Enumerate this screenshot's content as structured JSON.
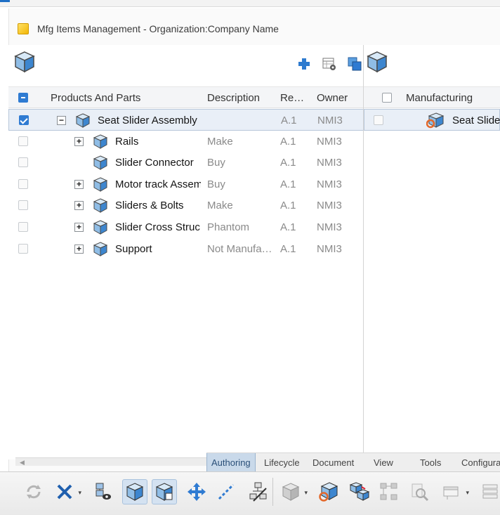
{
  "window": {
    "title": "Mfg Items Management - Organization:Company Name"
  },
  "left_pane": {
    "toolbar": {
      "add_icon": "plus-icon",
      "properties_icon": "table-gear-icon",
      "copy_icon": "copy-icon"
    },
    "columns": [
      "Products And Parts",
      "Description",
      "Re…",
      "Owner"
    ],
    "rows": [
      {
        "name": "Seat Slider Assembly",
        "description": "",
        "revision": "A.1",
        "owner": "NMI3",
        "expander": "−",
        "checked": true,
        "selected": true,
        "level": 0
      },
      {
        "name": "Rails",
        "description": "Make",
        "revision": "A.1",
        "owner": "NMI3",
        "expander": "+",
        "checked": false,
        "level": 1
      },
      {
        "name": "Slider Connector",
        "description": "Buy",
        "revision": "A.1",
        "owner": "NMI3",
        "expander": "",
        "checked": false,
        "level": 1
      },
      {
        "name": "Motor track Assem",
        "description": "Buy",
        "revision": "A.1",
        "owner": "NMI3",
        "expander": "+",
        "checked": false,
        "level": 1
      },
      {
        "name": "Sliders & Bolts",
        "description": "Make",
        "revision": "A.1",
        "owner": "NMI3",
        "expander": "+",
        "checked": false,
        "level": 1
      },
      {
        "name": "Slider Cross Struc",
        "description": "Phantom",
        "revision": "A.1",
        "owner": "NMI3",
        "expander": "+",
        "checked": false,
        "level": 1
      },
      {
        "name": "Support",
        "description": "Not Manufa…",
        "revision": "A.1",
        "owner": "NMI3",
        "expander": "+",
        "checked": false,
        "level": 1
      }
    ]
  },
  "right_pane": {
    "columns": [
      "Manufacturing"
    ],
    "rows": [
      {
        "name": "Seat Slider"
      }
    ]
  },
  "tabs": [
    "Authoring",
    "Lifecycle",
    "Document",
    "View",
    "Tools",
    "Configurat"
  ],
  "active_tab": "Authoring",
  "ribbon_icons": [
    "refresh-icon",
    "delete-icon",
    "part-view-icon",
    "product-cube-icon",
    "product-cube-alt-icon",
    "move-icon",
    "link-icon",
    "unlink-icon",
    "assign-cube-icon",
    "scope-cube-icon",
    "multi-cube-icon",
    "hierarchy-icon",
    "search-icon",
    "display-icon",
    "list-icon"
  ],
  "colors": {
    "accent": "#2f7bd2",
    "selection": "#e9eff7",
    "tab_active": "#c9d9ea"
  }
}
